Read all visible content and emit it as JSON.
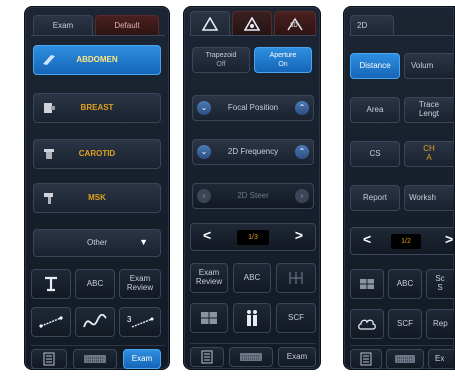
{
  "panel1": {
    "tabs": [
      "Exam",
      "Default"
    ],
    "presets": [
      {
        "label": "ABDOMEN",
        "icon": "abdomen-probe-icon"
      },
      {
        "label": "BREAST",
        "icon": "breast-probe-icon"
      },
      {
        "label": "CAROTID",
        "icon": "carotid-probe-icon"
      },
      {
        "label": "MSK",
        "icon": "msk-probe-icon"
      }
    ],
    "other_label": "Other",
    "grid": [
      {
        "label": "",
        "icon": "text-cursor-icon"
      },
      {
        "label": "ABC",
        "icon": ""
      },
      {
        "label": "Exam Review",
        "icon": ""
      },
      {
        "label": "",
        "icon": "caliper-line-icon"
      },
      {
        "label": "",
        "icon": "trace-curve-icon"
      },
      {
        "label": "",
        "icon": "three-point-icon"
      }
    ],
    "bottom": [
      {
        "label": "",
        "icon": "menu-icon"
      },
      {
        "label": "",
        "icon": "keyboard-icon"
      },
      {
        "label": "Exam",
        "icon": ""
      }
    ]
  },
  "panel2": {
    "tabs": [
      {
        "icon": "warning-triangle-icon"
      },
      {
        "icon": "settings-triangle-icon"
      },
      {
        "icon": "probe-3d-icon"
      }
    ],
    "toggles": [
      {
        "label": "Trapezoid",
        "value": "Off"
      },
      {
        "label": "Aperture",
        "value": "On"
      }
    ],
    "controls": [
      "Focal Position",
      "2D Frequency",
      "2D Steer"
    ],
    "pager": {
      "value": "1/3"
    },
    "grid": [
      {
        "label": "Exam Review",
        "icon": ""
      },
      {
        "label": "ABC",
        "icon": ""
      },
      {
        "label": "",
        "icon": "nt-measure-icon"
      },
      {
        "label": "",
        "icon": "split-screen-icon"
      },
      {
        "label": "",
        "icon": "body-marker-icon"
      },
      {
        "label": "SCF",
        "icon": ""
      }
    ],
    "bottom": [
      {
        "label": "",
        "icon": "menu-icon"
      },
      {
        "label": "",
        "icon": "keyboard-icon"
      },
      {
        "label": "Exam",
        "icon": ""
      }
    ]
  },
  "panel3": {
    "tab": "2D",
    "rows": [
      [
        "Distance",
        "Volum"
      ],
      [
        "Area",
        "Trace Lengt"
      ],
      [
        "CS",
        "CH A"
      ],
      [
        "Report",
        "Worksh"
      ]
    ],
    "pager": {
      "value": "1/2"
    },
    "grid": [
      {
        "label": "",
        "icon": "split-screen-icon"
      },
      {
        "label": "ABC",
        "icon": ""
      },
      {
        "label": "Sc S",
        "icon": ""
      },
      {
        "label": "",
        "icon": "cloud-shape-icon"
      },
      {
        "label": "SCF",
        "icon": ""
      },
      {
        "label": "Rep",
        "icon": ""
      }
    ],
    "bottom": [
      {
        "label": "",
        "icon": "menu-icon"
      },
      {
        "label": "",
        "icon": "keyboard-icon"
      },
      {
        "label": "Ex",
        "icon": ""
      }
    ]
  }
}
